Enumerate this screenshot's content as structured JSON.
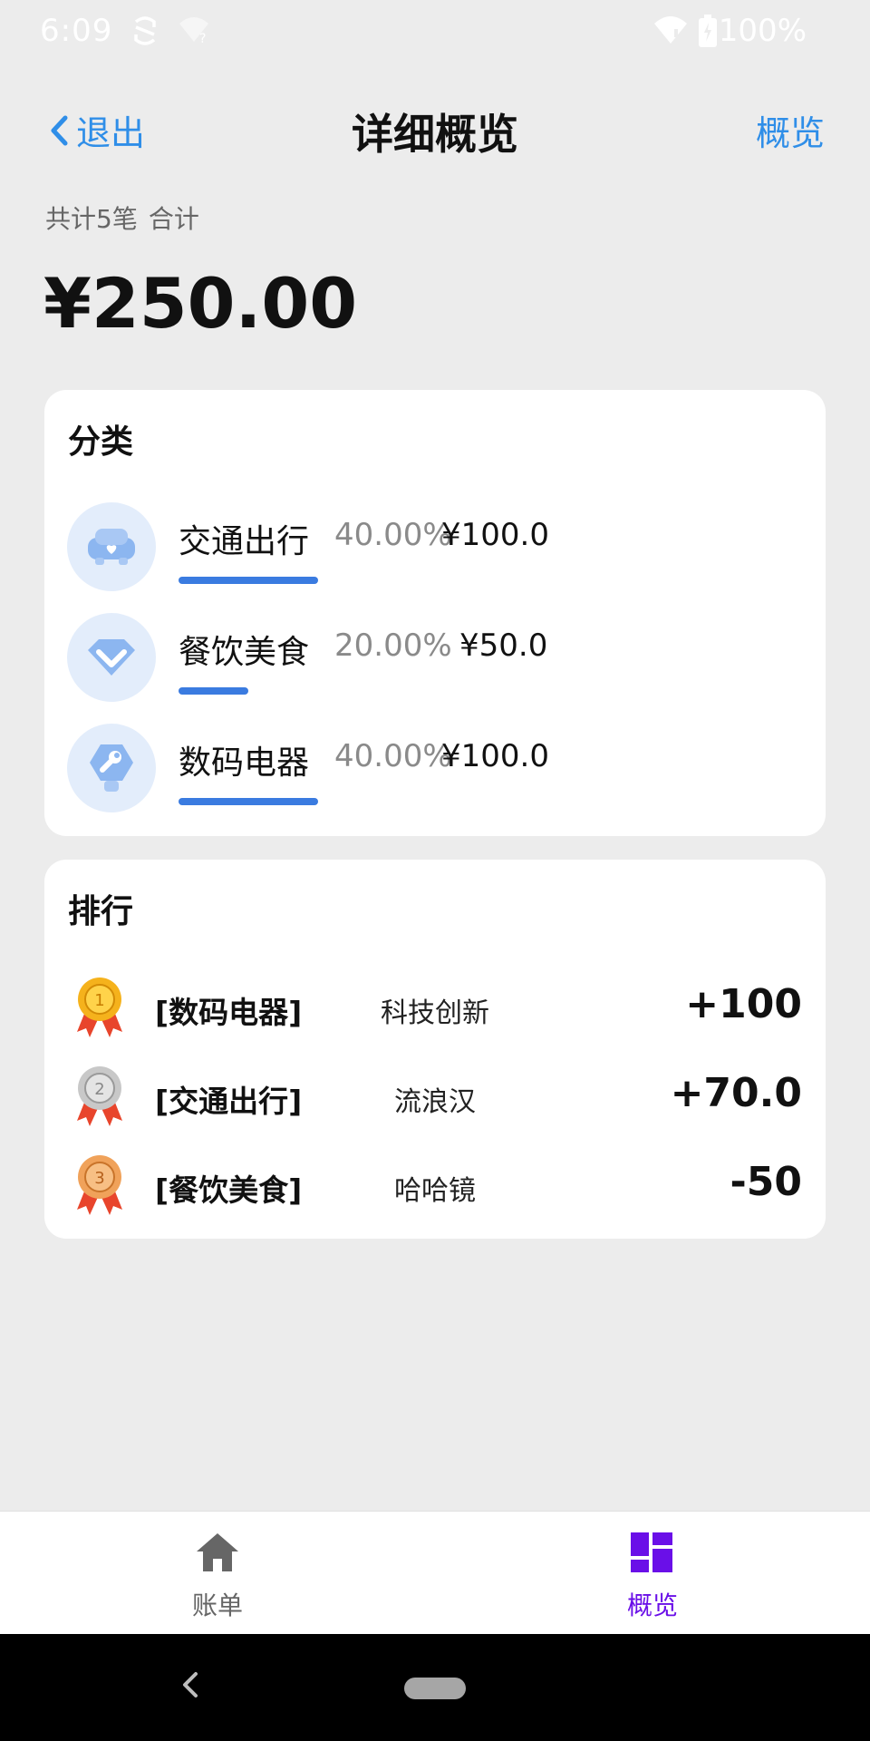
{
  "status_bar": {
    "time": "6:09",
    "battery": "100%"
  },
  "nav": {
    "back_label": "退出",
    "title": "详细概览",
    "right_label": "概览"
  },
  "summary": {
    "count_label": "共计5笔",
    "sum_label": "合计",
    "total": "¥250.00"
  },
  "categories": {
    "title": "分类",
    "items": [
      {
        "name": "交通出行",
        "percent": "40.00%",
        "amount": "¥100.0",
        "fraction": 0.4,
        "icon": "car-icon"
      },
      {
        "name": "餐饮美食",
        "percent": "20.00%",
        "amount": "¥50.0",
        "fraction": 0.2,
        "icon": "diamond-icon"
      },
      {
        "name": "数码电器",
        "percent": "40.00%",
        "amount": "¥100.0",
        "fraction": 0.4,
        "icon": "wrench-icon"
      }
    ]
  },
  "ranking": {
    "title": "排行",
    "items": [
      {
        "rank": "1",
        "category": "[数码电器]",
        "note": "科技创新",
        "amount": "+100",
        "medal_color": "#f5b21c"
      },
      {
        "rank": "2",
        "category": "[交通出行]",
        "note": "流浪汉",
        "amount": "+70.0",
        "medal_color": "#c8c8c8"
      },
      {
        "rank": "3",
        "category": "[餐饮美食]",
        "note": "哈哈镜",
        "amount": "-50",
        "medal_color": "#f0a25a"
      }
    ]
  },
  "tabs": [
    {
      "label": "账单",
      "icon": "home-icon",
      "active": false
    },
    {
      "label": "概览",
      "icon": "dashboard-icon",
      "active": true
    }
  ],
  "colors": {
    "accent": "#2f8ee8",
    "progress": "#3a7be0",
    "active_tab": "#6a0fe8"
  }
}
